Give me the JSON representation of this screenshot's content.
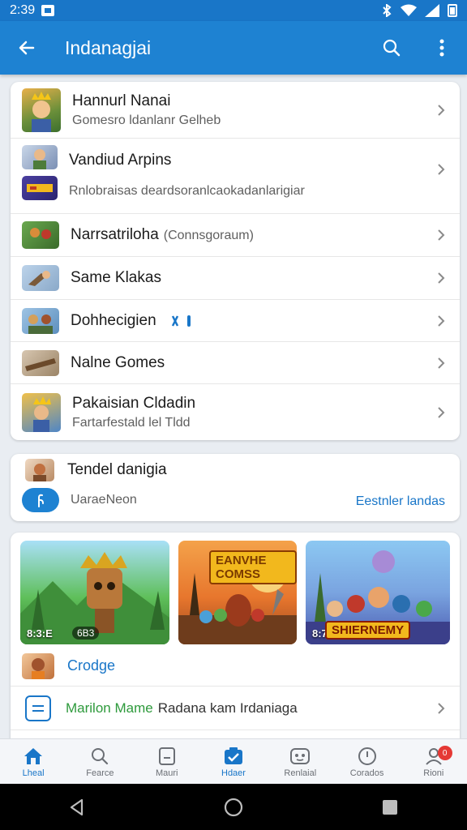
{
  "status_bar": {
    "time": "2:39"
  },
  "app_bar": {
    "title": "Indanagjai"
  },
  "list": {
    "items": [
      {
        "title": "Hannurl Nanai",
        "subtitle": "Gomesro ldanlanr Gelheb"
      },
      {
        "title": "Vandiud Arpins",
        "subtitle": "Rnlobraisas deardsoranlcaokadanlarigiar"
      },
      {
        "title": "Narrsatriloha",
        "suffix": "(Connsgoraum)"
      },
      {
        "title": "Same Klakas"
      },
      {
        "title": "Dohhecigien"
      },
      {
        "title": "Nalne Gomes"
      },
      {
        "title": "Pakaisian Cldadin",
        "subtitle": "Fartarfestald lel Tldd"
      }
    ]
  },
  "trend_card": {
    "title": "Tendel danigia",
    "action_label": "UaraeNeon",
    "link": "Eestnler landas"
  },
  "featured": {
    "tiles": [
      {
        "label": "8:3:E",
        "caption": ""
      },
      {
        "label": "",
        "caption": "EANVHE COMSS"
      },
      {
        "label": "8:73",
        "caption": "SHIERNEMY"
      }
    ],
    "tile_counter": "6B3",
    "category_label": "Crodge",
    "footer": {
      "highlight": "Marilon Mame",
      "rest": "Radana kam Irdaniaga"
    }
  },
  "bottom_nav": {
    "items": [
      {
        "label": "Lheal",
        "icon": "home-icon"
      },
      {
        "label": "Fearce",
        "icon": "search-icon"
      },
      {
        "label": "Mauri",
        "icon": "library-icon"
      },
      {
        "label": "Hdaer",
        "icon": "check-badge-icon"
      },
      {
        "label": "Renlaial",
        "icon": "controller-icon"
      },
      {
        "label": "Corados",
        "icon": "clock-icon"
      },
      {
        "label": "Rioni",
        "icon": "profile-icon"
      }
    ],
    "badge_count": "0"
  },
  "colors": {
    "primary": "#1e82d2",
    "status": "#1976c8",
    "link": "#1976c8",
    "highlight": "#2e9a3c"
  }
}
